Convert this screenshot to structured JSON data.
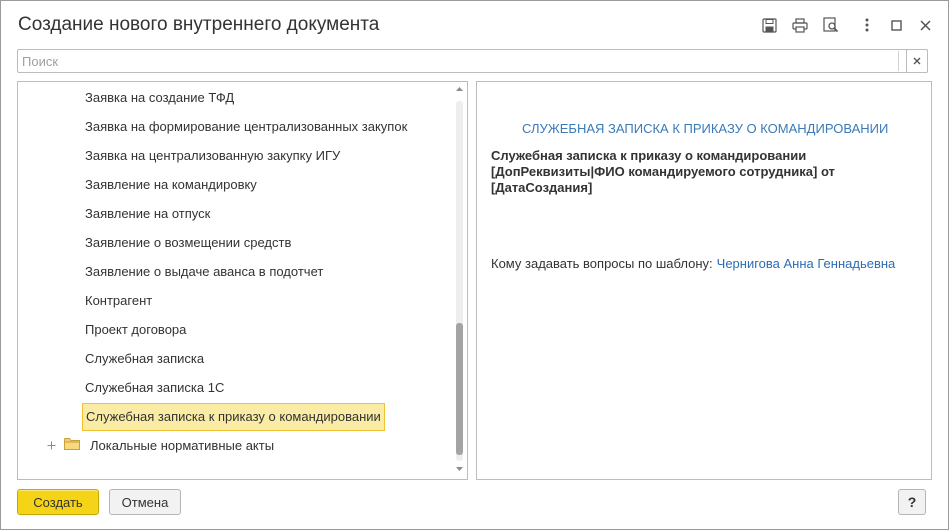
{
  "window": {
    "title": "Создание нового внутреннего документа",
    "controls": [
      "save-icon",
      "print-icon",
      "preview-icon",
      "more-icon",
      "maximize-icon",
      "close-icon"
    ]
  },
  "search": {
    "placeholder": "Поиск",
    "value": ""
  },
  "tree": {
    "items": [
      {
        "label": "Заявка на создание ТФД"
      },
      {
        "label": "Заявка на формирование централизованных закупок"
      },
      {
        "label": "Заявка на централизованную закупку ИГУ"
      },
      {
        "label": "Заявление на командировку"
      },
      {
        "label": "Заявление на отпуск"
      },
      {
        "label": "Заявление о возмещении средств"
      },
      {
        "label": "Заявление о выдаче аванса в подотчет"
      },
      {
        "label": "Контрагент"
      },
      {
        "label": "Проект договора"
      },
      {
        "label": "Служебная записка"
      },
      {
        "label": "Служебная записка 1С"
      }
    ],
    "selected": {
      "label": "Служебная записка к приказу о командировании"
    },
    "group": {
      "label": "Локальные нормативные акты",
      "expander_icon": "expand-plus-icon",
      "icon": "folder-icon"
    }
  },
  "preview": {
    "title": "СЛУЖЕБНАЯ ЗАПИСКА К ПРИКАЗУ О КОМАНДИРОВАНИИ",
    "body_lines": [
      "Служебная записка к приказу о командировании",
      "[ДопРеквизиты|ФИО командируемого сотрудника] от",
      "[ДатаСоздания]"
    ],
    "contact_label": "Кому задавать вопросы по шаблону:",
    "contact_name": "Чернигова Анна Геннадьевна"
  },
  "buttons": {
    "create": "Создать",
    "cancel": "Отмена",
    "help": "?"
  },
  "colors": {
    "accent_yellow": "#f5d418",
    "selection_bg": "#fbeca5",
    "selection_border": "#f1c232",
    "link_blue": "#2d6cb3",
    "preview_title_blue": "#3a7ab8"
  }
}
